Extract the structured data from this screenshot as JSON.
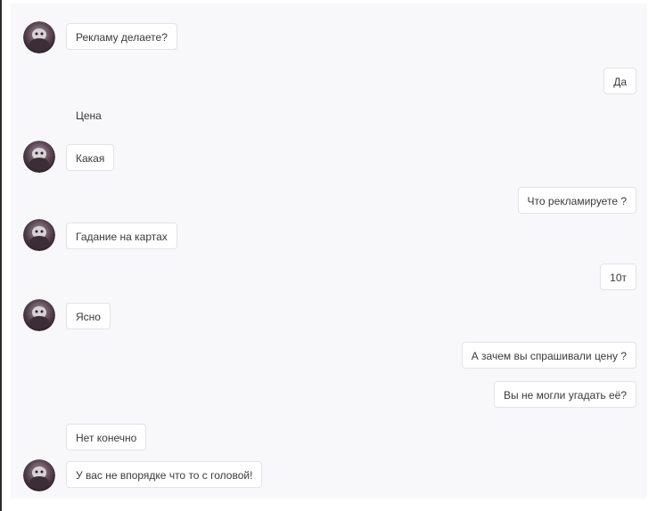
{
  "colors": {
    "background": "#f8f8fa",
    "bubble": "#ffffff",
    "bubble_border": "#e4e4e7",
    "text": "#3a3a3a"
  },
  "messages": [
    {
      "direction": "incoming",
      "text": "Рекламу делаете?",
      "avatar": true
    },
    {
      "direction": "outgoing",
      "text": "Да"
    },
    {
      "direction": "incoming",
      "text": "Цена",
      "avatar": false
    },
    {
      "direction": "incoming",
      "text": "Какая",
      "avatar": true
    },
    {
      "direction": "outgoing",
      "text": "Что рекламируете ?"
    },
    {
      "direction": "incoming",
      "text": "Гадание на картах",
      "avatar": true
    },
    {
      "direction": "outgoing",
      "text": "10т"
    },
    {
      "direction": "incoming",
      "text": "Ясно",
      "avatar": true
    },
    {
      "direction": "outgoing",
      "text": "А зачем вы спрашивали цену ?"
    },
    {
      "direction": "outgoing",
      "text": "Вы не могли угадать её?"
    },
    {
      "direction": "incoming",
      "text": "Нет конечно",
      "avatar": false
    },
    {
      "direction": "incoming",
      "text": "У вас не впорядке что то с головой!",
      "avatar": true
    }
  ],
  "avatar_icon": "contact-avatar-icon"
}
